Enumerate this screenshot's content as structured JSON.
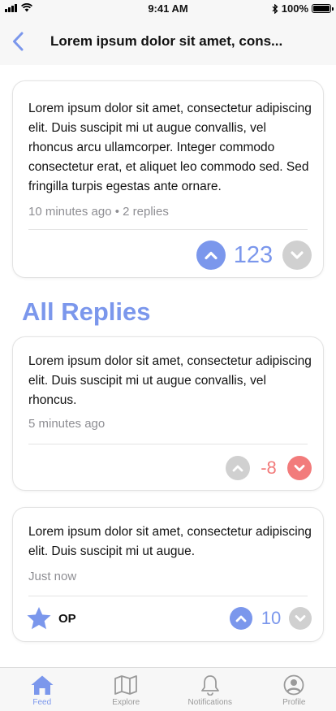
{
  "status_bar": {
    "time": "9:41 AM",
    "battery": "100%",
    "signal_icon": "signal-bars-icon",
    "wifi_icon": "wifi-icon",
    "bluetooth_icon": "bluetooth-icon"
  },
  "nav": {
    "title": "Lorem ipsum dolor sit amet, cons...",
    "back_icon": "chevron-left-icon"
  },
  "post": {
    "body": "Lorem ipsum dolor sit amet, consectetur adipiscing elit. Duis suscipit mi ut augue convallis, vel rhoncus arcu ullamcorper. Integer commodo consectetur erat, et aliquet leo commodo sed. Sed fringilla turpis egestas ante ornare.",
    "meta": "10 minutes ago • 2 replies",
    "score": "123",
    "upvoted": true,
    "downvoted": false
  },
  "replies_heading": "All Replies",
  "replies": [
    {
      "body": "Lorem ipsum dolor sit amet, consectetur adipiscing elit. Duis suscipit mi ut augue convallis, vel rhoncus.",
      "meta": "5 minutes ago",
      "score": "-8",
      "upvoted": false,
      "downvoted": true
    },
    {
      "body": "Lorem ipsum dolor sit amet, consectetur adipiscing elit. Duis suscipit mi ut augue.",
      "meta": "Just now",
      "score": "10",
      "upvoted": true,
      "downvoted": false,
      "badge": "OP",
      "badge_icon": "star-icon"
    }
  ],
  "tabs": [
    {
      "label": "Feed",
      "icon": "home-icon",
      "active": true
    },
    {
      "label": "Explore",
      "icon": "map-icon",
      "active": false
    },
    {
      "label": "Notifications",
      "icon": "bell-icon",
      "active": false
    },
    {
      "label": "Profile",
      "icon": "user-circle-icon",
      "active": false
    }
  ],
  "colors": {
    "accent": "#7b97ec",
    "upvote_active": "#7b97ec",
    "downvote_active": "#f27b7b",
    "vote_inactive": "#d0d0d0",
    "meta_text": "#8e8e93",
    "bar_background": "#f7f7f7"
  }
}
